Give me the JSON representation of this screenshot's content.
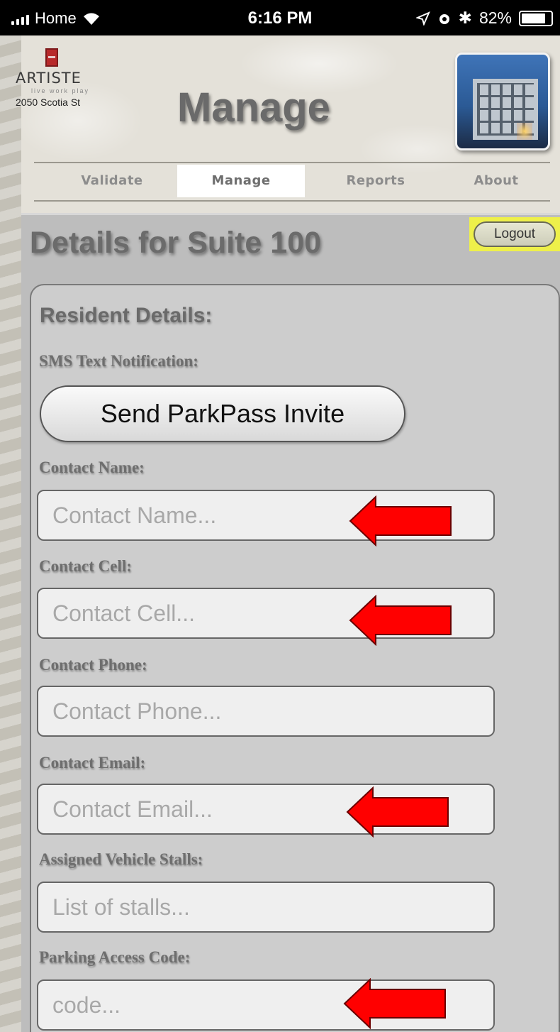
{
  "status_bar": {
    "carrier": "Home",
    "time": "6:16 PM",
    "battery": "82%",
    "battery_level": 0.82
  },
  "header": {
    "logo": {
      "small": "THE",
      "name": "ARTISTE",
      "tagline": "live work play",
      "address": "2050 Scotia St"
    },
    "title": "Manage",
    "tabs": [
      {
        "label": "Validate",
        "active": false
      },
      {
        "label": "Manage",
        "active": true
      },
      {
        "label": "Reports",
        "active": false
      },
      {
        "label": "About",
        "active": false
      }
    ]
  },
  "main": {
    "title": "Details for Suite 100",
    "logout_label": "Logout",
    "section_title": "Resident Details:",
    "sms_label": "SMS Text Notification:",
    "invite_button": "Send ParkPass Invite",
    "fields": [
      {
        "label": "Contact Name:",
        "placeholder": "Contact Name...",
        "value": ""
      },
      {
        "label": "Contact Cell:",
        "placeholder": "Contact Cell...",
        "value": ""
      },
      {
        "label": "Contact Phone:",
        "placeholder": "Contact Phone...",
        "value": ""
      },
      {
        "label": "Contact Email:",
        "placeholder": "Contact Email...",
        "value": ""
      },
      {
        "label": "Assigned Vehicle Stalls:",
        "placeholder": "List of stalls...",
        "value": ""
      },
      {
        "label": "Parking Access Code:",
        "placeholder": "code...",
        "value": ""
      }
    ]
  },
  "colors": {
    "arrow": "#ff0000",
    "logout_highlight": "#eef04a",
    "active_tab": "#ffffff"
  }
}
